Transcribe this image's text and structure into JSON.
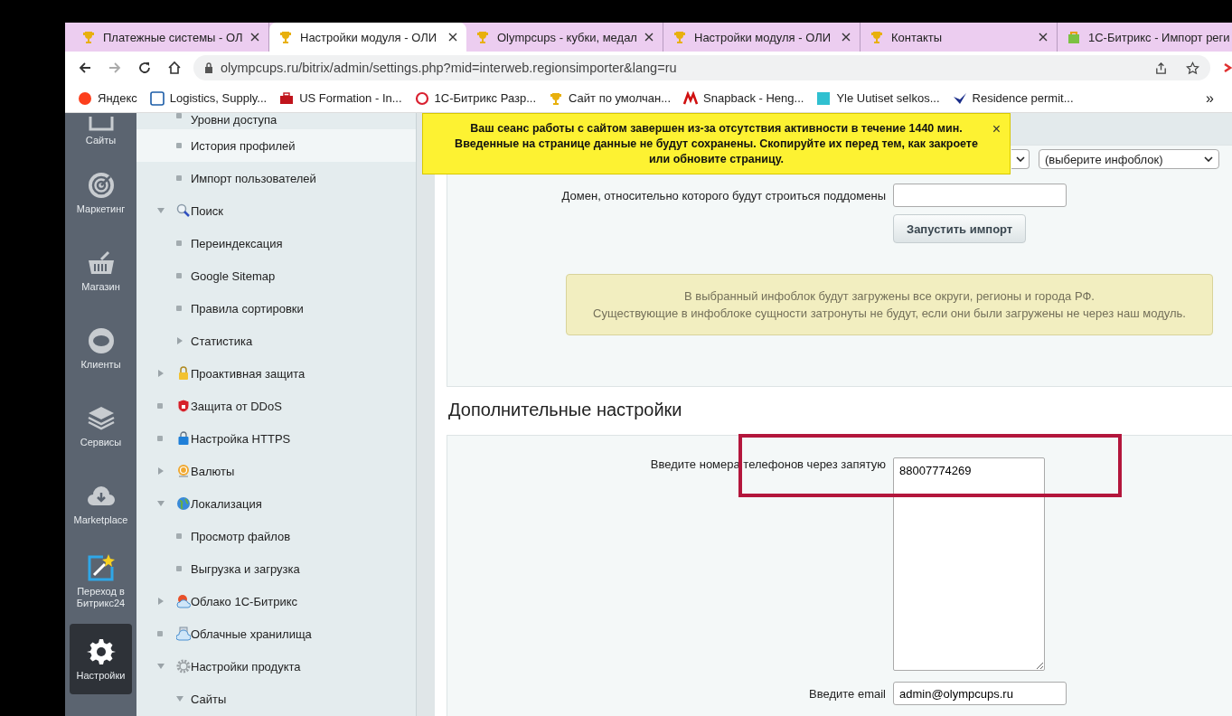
{
  "browser": {
    "tabs": [
      {
        "title": "Платежные системы - ОЛ",
        "kind": "trophy",
        "selected": false
      },
      {
        "title": "Настройки модуля - ОЛИ",
        "kind": "trophy",
        "selected": true
      },
      {
        "title": "Olympcups - кубки, медал",
        "kind": "trophy",
        "selected": false
      },
      {
        "title": "Настройки модуля - ОЛИ",
        "kind": "trophy",
        "selected": false
      },
      {
        "title": "Контакты",
        "kind": "trophy",
        "selected": false
      },
      {
        "title": "1С-Битрикс - Импорт реги",
        "kind": "bag",
        "selected": false
      }
    ],
    "url": "olympcups.ru/bitrix/admin/settings.php?mid=interweb.regionsimporter&lang=ru",
    "bookmarks": [
      {
        "label": "Яндекс",
        "kind": "yandex"
      },
      {
        "label": "Logistics, Supply...",
        "kind": "box"
      },
      {
        "label": "US Formation - In...",
        "kind": "briefcase"
      },
      {
        "label": "1С-Битрикс Разр...",
        "kind": "bitrix"
      },
      {
        "label": "Сайт по умолчан...",
        "kind": "trophy"
      },
      {
        "label": "Snapback - Heng...",
        "kind": "snapback"
      },
      {
        "label": "Yle Uutiset selkos...",
        "kind": "yle"
      },
      {
        "label": "Residence permit...",
        "kind": "migri"
      }
    ],
    "more": "»"
  },
  "sidebar": {
    "items": [
      {
        "label": "Сайты",
        "kind": "sites",
        "selected": false
      },
      {
        "label": "Маркетинг",
        "kind": "marketing",
        "selected": false
      },
      {
        "label": "Магазин",
        "kind": "shop",
        "selected": false
      },
      {
        "label": "Клиенты",
        "kind": "clients",
        "selected": false
      },
      {
        "label": "Сервисы",
        "kind": "services",
        "selected": false
      },
      {
        "label": "Marketplace",
        "kind": "marketplace",
        "selected": false
      },
      {
        "label": "Переход в Битрикс24",
        "kind": "b24",
        "selected": false
      },
      {
        "label": "Настройки",
        "kind": "settings",
        "selected": true
      }
    ]
  },
  "menu": {
    "items": [
      {
        "children": [
          {
            "label": "Уровни доступа",
            "selected": false
          },
          {
            "label": "История профилей",
            "selected": true
          },
          {
            "label": "Импорт пользователей",
            "selected": false
          }
        ]
      },
      {
        "label": "Поиск",
        "kind": "search",
        "expanded": true,
        "selected": false,
        "children": [
          {
            "label": "Переиндексация",
            "selected": false
          },
          {
            "label": "Google Sitemap",
            "selected": false
          },
          {
            "label": "Правила сортировки",
            "selected": false
          },
          {
            "label": "Статистика",
            "expanded": false,
            "selected": false
          }
        ]
      },
      {
        "label": "Проактивная защита",
        "kind": "lock",
        "expanded": false,
        "selected": false
      },
      {
        "label": "Защита от DDoS",
        "kind": "shield",
        "selected": false
      },
      {
        "label": "Настройка HTTPS",
        "kind": "https",
        "selected": false
      },
      {
        "label": "Валюты",
        "kind": "coin",
        "expanded": false,
        "selected": false
      },
      {
        "label": "Локализация",
        "kind": "globe",
        "expanded": true,
        "selected": false,
        "children": [
          {
            "label": "Просмотр файлов",
            "selected": false
          },
          {
            "label": "Выгрузка и загрузка",
            "selected": false
          }
        ]
      },
      {
        "label": "Облако 1С-Битрикс",
        "kind": "bxcloud",
        "expanded": false,
        "selected": false
      },
      {
        "label": "Облачные хранилища",
        "kind": "storage",
        "selected": false
      },
      {
        "label": "Настройки продукта",
        "kind": "gear",
        "expanded": true,
        "selected": false,
        "children": [
          {
            "label": "Сайты",
            "expanded": true,
            "selected": false
          }
        ]
      }
    ]
  },
  "notice": {
    "text": "Ваш сеанс работы с сайтом завершен из-за отсутствия активности в течение 1440 мин. Введенные на странице данные не будут сохранены. Скопируйте их перед тем, как закроете или обновите страницу.",
    "close": "×"
  },
  "import_panel": {
    "iblock_select": "(выберите инфоблок)",
    "domain_label": "Домен, относительно которого будут строиться поддомены",
    "button": "Запустить импорт",
    "info": [
      "В выбранный инфоблок будут загружены все округи, регионы и города РФ.",
      "Существующие в инфоблоке сущности затронуты не будут, если они были загружены не через наш модуль."
    ]
  },
  "extra": {
    "title": "Дополнительные настройки",
    "phones_label": "Введите номера телефонов через запятую",
    "phones_value": "88007774269",
    "email_label": "Введите email",
    "email_value": "admin@olympcups.ru"
  }
}
